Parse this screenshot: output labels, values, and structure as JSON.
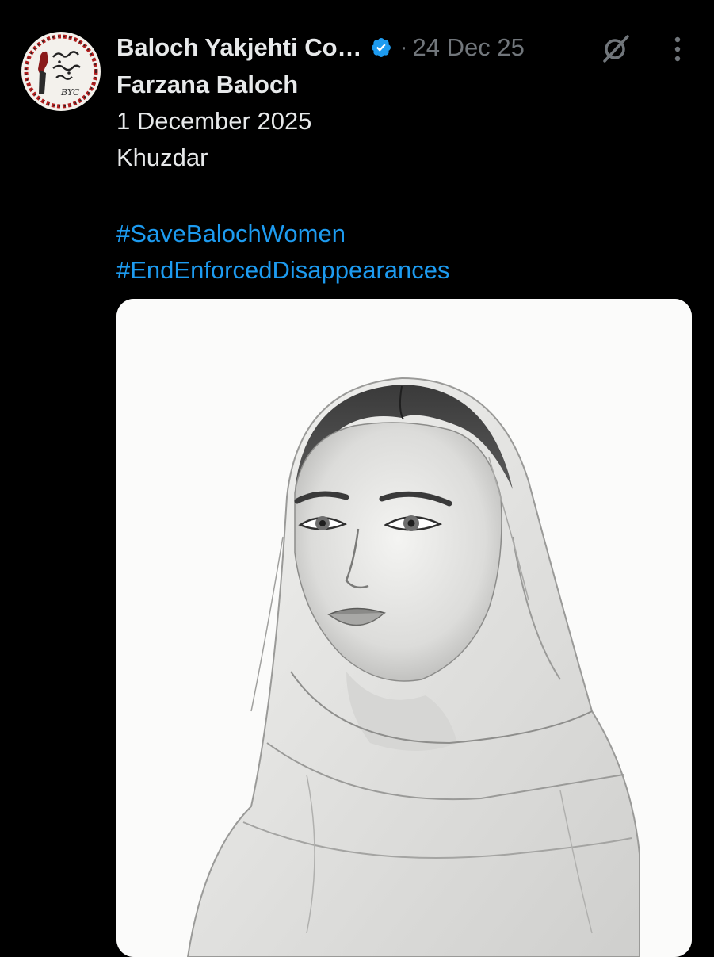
{
  "post": {
    "author": {
      "display_name": "Baloch Yakjehti Co…",
      "verified": true,
      "avatar_icon": "byc-logo-icon",
      "avatar_logo_text": "BYC"
    },
    "separator": "·",
    "timestamp": "24 Dec 25",
    "actions": {
      "grok_icon": "grok-icon",
      "more_icon": "more-vertical-icon"
    },
    "text": {
      "name": "Farzana Baloch",
      "date": "1 December 2025",
      "place": "Khuzdar"
    },
    "hashtags": [
      "#SaveBalochWomen",
      "#EndEnforcedDisappearances"
    ],
    "media": {
      "type": "image",
      "subject_icon": "pencil-sketch-portrait"
    }
  },
  "colors": {
    "background": "#000000",
    "text": "#e7e9ea",
    "muted": "#71767b",
    "link": "#1d9bf0",
    "verified_badge": "#1d9bf0"
  }
}
